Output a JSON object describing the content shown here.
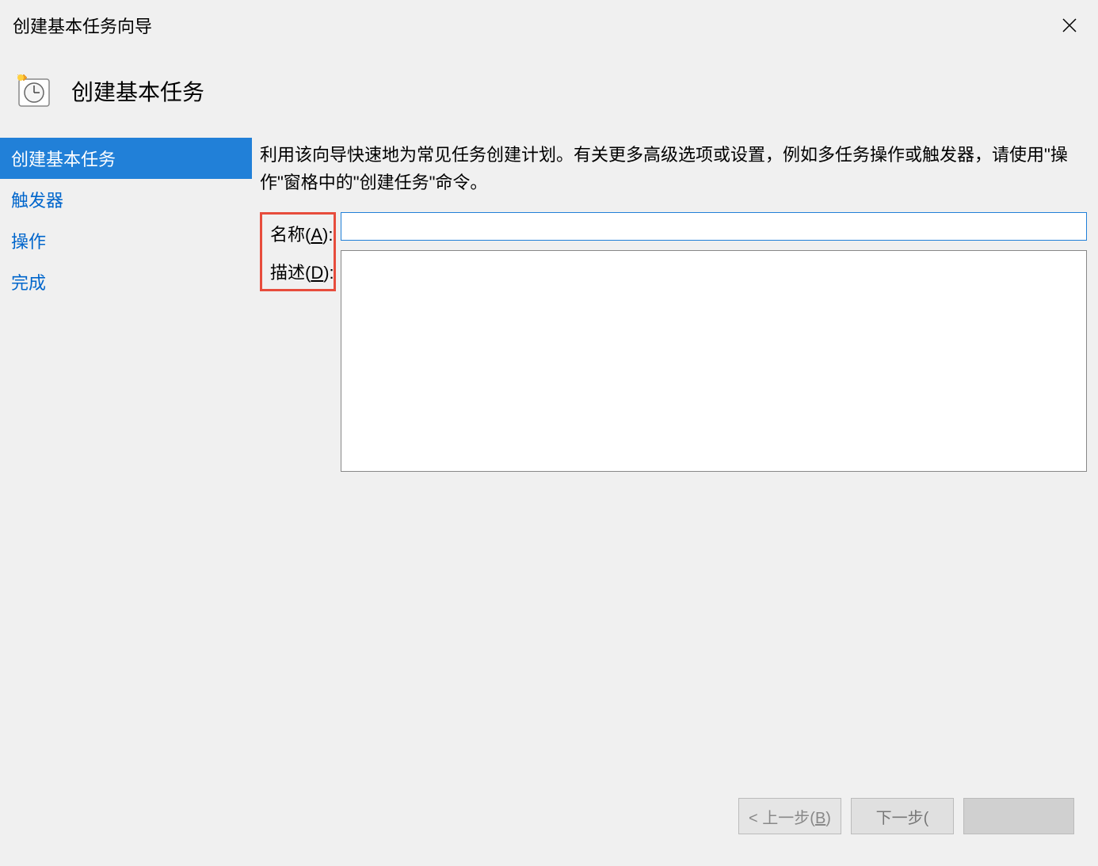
{
  "window": {
    "title": "创建基本任务向导"
  },
  "header": {
    "title": "创建基本任务"
  },
  "sidebar": {
    "items": [
      {
        "label": "创建基本任务",
        "selected": true
      },
      {
        "label": "触发器",
        "selected": false
      },
      {
        "label": "操作",
        "selected": false
      },
      {
        "label": "完成",
        "selected": false
      }
    ]
  },
  "main": {
    "description": "利用该向导快速地为常见任务创建计划。有关更多高级选项或设置，例如多任务操作或触发器，请使用\"操作\"窗格中的\"创建任务\"命令。",
    "name_label_prefix": "名称(",
    "name_label_key": "A",
    "name_label_suffix": "):",
    "desc_label_prefix": "描述(",
    "desc_label_key": "D",
    "desc_label_suffix": "):",
    "name_value": "",
    "desc_value": ""
  },
  "buttons": {
    "back_prefix": "< 上一步(",
    "back_key": "B",
    "back_suffix": ")",
    "next_prefix": "下一步(",
    "next_key": "",
    "next_suffix": ""
  }
}
